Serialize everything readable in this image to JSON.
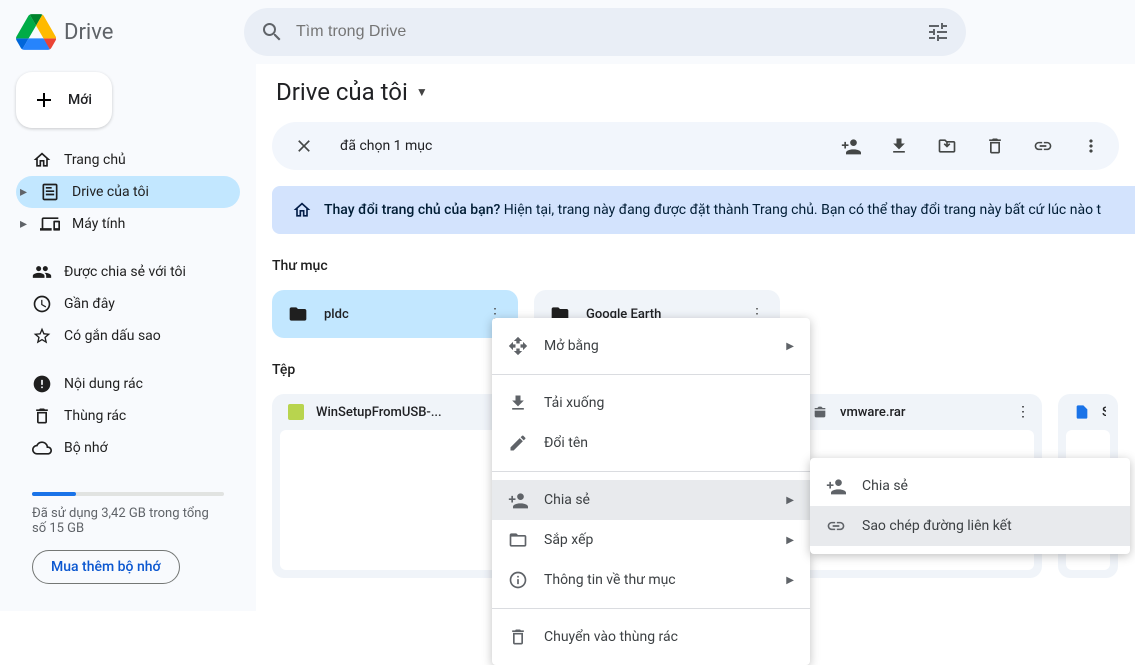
{
  "app": {
    "title": "Drive"
  },
  "search": {
    "placeholder": "Tìm trong Drive"
  },
  "newButton": {
    "label": "Mới"
  },
  "sidebar": {
    "items": [
      {
        "label": "Trang chủ"
      },
      {
        "label": "Drive của tôi"
      },
      {
        "label": "Máy tính"
      }
    ],
    "items2": [
      {
        "label": "Được chia sẻ với tôi"
      },
      {
        "label": "Gần đây"
      },
      {
        "label": "Có gắn dấu sao"
      }
    ],
    "items3": [
      {
        "label": "Nội dung rác"
      },
      {
        "label": "Thùng rác"
      },
      {
        "label": "Bộ nhớ"
      }
    ]
  },
  "storage": {
    "text": "Đã sử dụng 3,42 GB trong tổng số 15 GB",
    "buy": "Mua thêm bộ nhớ"
  },
  "location": {
    "title": "Drive của tôi"
  },
  "selection": {
    "text": "đã chọn 1 mục"
  },
  "banner": {
    "bold": "Thay đổi trang chủ của bạn?",
    "rest": "Hiện tại, trang này đang được đặt thành Trang chủ. Bạn có thể thay đổi trang này bất cứ lúc nào t"
  },
  "sections": {
    "folders": "Thư mục",
    "files": "Tệp"
  },
  "folders": [
    {
      "name": "pldc"
    },
    {
      "name": "Google Earth"
    }
  ],
  "files": [
    {
      "name": "WinSetupFromUSB-..."
    },
    {
      "name": "vmware.rar"
    },
    {
      "name": "S"
    }
  ],
  "ctx": {
    "open": "Mở bằng",
    "download": "Tải xuống",
    "rename": "Đổi tên",
    "share": "Chia sẻ",
    "organize": "Sắp xếp",
    "info": "Thông tin về thư mục",
    "trash": "Chuyển vào thùng rác"
  },
  "ctxSub": {
    "share": "Chia sẻ",
    "link": "Sao chép đường liên kết"
  }
}
